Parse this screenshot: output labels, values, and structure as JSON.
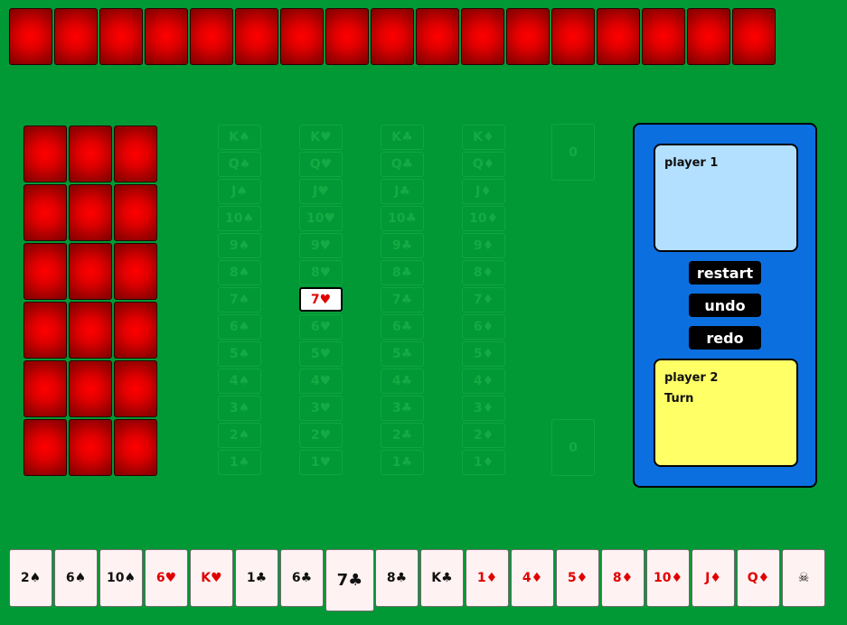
{
  "opponent_hand": {
    "count": 17,
    "card_back_color": "#ff0000"
  },
  "deck": {
    "columns": 3,
    "rows": 6,
    "card_back_color": "#ff0000"
  },
  "foundations": [
    {
      "suit": "spades",
      "labels": [
        "K♠",
        "Q♠",
        "J♠",
        "10♠",
        "9♠",
        "8♠",
        "7♠",
        "6♠",
        "5♠",
        "4♠",
        "3♠",
        "2♠",
        "1♠"
      ]
    },
    {
      "suit": "hearts",
      "labels": [
        "K♥",
        "Q♥",
        "J♥",
        "10♥",
        "9♥",
        "8♥",
        "",
        "6♥",
        "5♥",
        "4♥",
        "3♥",
        "2♥",
        "1♥"
      ],
      "played_card": {
        "label": "7♥",
        "color": "red"
      }
    },
    {
      "suit": "clubs",
      "labels": [
        "K♣",
        "Q♣",
        "J♣",
        "10♣",
        "9♣",
        "8♣",
        "7♣",
        "6♣",
        "5♣",
        "4♣",
        "3♣",
        "2♣",
        "1♣"
      ]
    },
    {
      "suit": "diamonds",
      "labels": [
        "K♦",
        "Q♦",
        "J♦",
        "10♦",
        "9♦",
        "8♦",
        "7♦",
        "6♦",
        "5♦",
        "4♦",
        "3♦",
        "2♦",
        "1♦"
      ]
    }
  ],
  "scores": {
    "player1_count": "0",
    "player2_count": "0"
  },
  "panel": {
    "player1": {
      "name": "player 1",
      "status": ""
    },
    "player2": {
      "name": "player 2",
      "status": "Turn"
    },
    "buttons": {
      "restart": "restart",
      "undo": "undo",
      "redo": "redo"
    }
  },
  "player_hand": [
    {
      "label": "2♠",
      "color": "black"
    },
    {
      "label": "6♠",
      "color": "black"
    },
    {
      "label": "10♠",
      "color": "black"
    },
    {
      "label": "6♥",
      "color": "red"
    },
    {
      "label": "K♥",
      "color": "red"
    },
    {
      "label": "1♣",
      "color": "black"
    },
    {
      "label": "6♣",
      "color": "black"
    },
    {
      "label": "7♣",
      "color": "black",
      "selected": true
    },
    {
      "label": "8♣",
      "color": "black"
    },
    {
      "label": "K♣",
      "color": "black"
    },
    {
      "label": "1♦",
      "color": "red"
    },
    {
      "label": "4♦",
      "color": "red"
    },
    {
      "label": "5♦",
      "color": "red"
    },
    {
      "label": "8♦",
      "color": "red"
    },
    {
      "label": "10♦",
      "color": "red"
    },
    {
      "label": "J♦",
      "color": "red"
    },
    {
      "label": "Q♦",
      "color": "red"
    },
    {
      "label": "☠",
      "color": "black"
    }
  ],
  "colors": {
    "table": "#019935",
    "panel": "#0b6fe0",
    "player1_box": "#b3e0ff",
    "player2_box": "#ffff66",
    "red_suit": "#e00000"
  }
}
